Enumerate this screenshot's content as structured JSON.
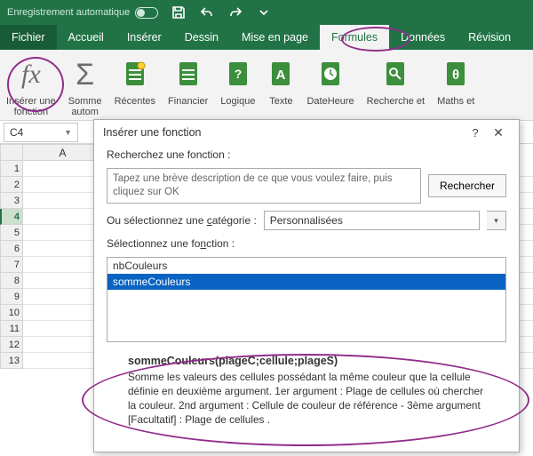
{
  "titlebar": {
    "autosave_label": "Enregistrement automatique"
  },
  "tabs": {
    "file": "Fichier",
    "home": "Accueil",
    "insert": "Insérer",
    "draw": "Dessin",
    "layout": "Mise en page",
    "formulas": "Formules",
    "data": "Données",
    "review": "Révision"
  },
  "ribbon": {
    "insert_fn": "Insérer une\nfonction",
    "autosum": "Somme\nautom",
    "recent": "Récentes",
    "financial": "Financier",
    "logical": "Logique",
    "text": "Texte",
    "datetime": "DateHeure",
    "lookup": "Recherche et",
    "math": "Maths et"
  },
  "namebox": {
    "ref": "C4"
  },
  "grid": {
    "col_a": "A",
    "rows": [
      "1",
      "2",
      "3",
      "4",
      "5",
      "6",
      "7",
      "8",
      "9",
      "10",
      "11",
      "12",
      "13"
    ]
  },
  "dialog": {
    "title": "Insérer une fonction",
    "search_label": "Recherchez une fonction :",
    "search_placeholder": "Tapez une brève description de ce que vous voulez faire, puis cliquez sur OK",
    "search_btn": "Rechercher",
    "cat_pre": "Ou sélectionnez une ",
    "cat_u": "c",
    "cat_post": "atégorie : ",
    "cat_value": "Personnalisées",
    "list_pre": "Sélectionnez une fo",
    "list_u": "n",
    "list_post": "ction :",
    "functions": [
      "nbCouleurs",
      "sommeCouleurs"
    ],
    "selected_idx": 1,
    "signature": "sommeCouleurs(plageC;cellule;plageS)",
    "description": "Somme les valeurs des cellules possédant la même couleur que la cellule définie en deuxième argument. 1er argument : Plage de cellules où chercher la couleur. 2nd argument : Cellule de couleur de référence - 3ème argument [Facultatif] : Plage de cellules ."
  }
}
